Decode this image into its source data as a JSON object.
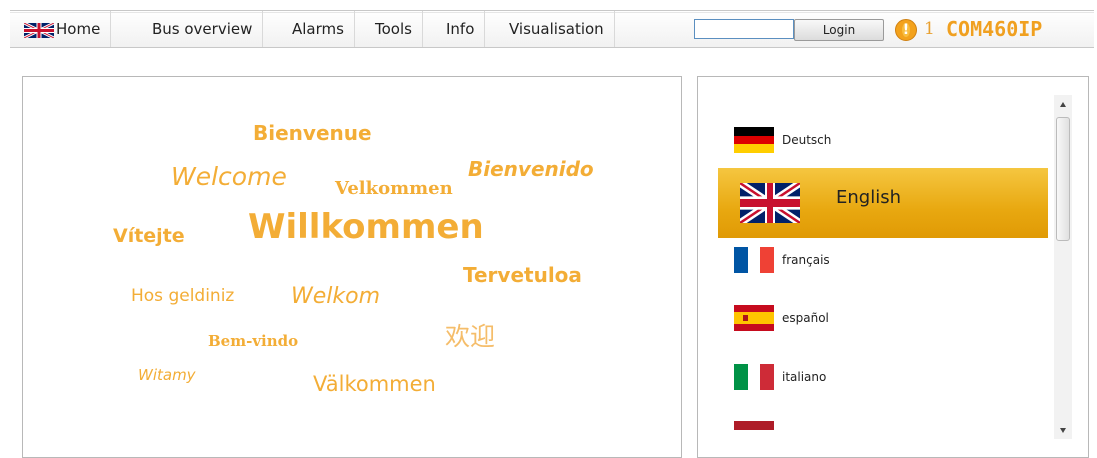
{
  "nav": {
    "home": "Home",
    "bus_overview": "Bus overview",
    "alarms": "Alarms",
    "tools": "Tools",
    "info": "Info",
    "visualisation": "Visualisation"
  },
  "login": {
    "input_value": "",
    "button": "Login"
  },
  "alarm": {
    "icon": "warning-icon",
    "count": "1"
  },
  "device_name": "COM460IP",
  "accent_color": "#f3ad36",
  "welcome_words": [
    "Bienvenue",
    "Welcome",
    "Velkommen",
    "Bienvenido",
    "Vítejte",
    "Willkommen",
    "Tervetuloa",
    "Hos geldiniz",
    "Welkom",
    "欢迎",
    "Bem-vindo",
    "Witamy",
    "Välkommen"
  ],
  "languages": {
    "deutsch": "Deutsch",
    "english": "English",
    "francais": "français",
    "espanol": "español",
    "italiano": "italiano"
  }
}
